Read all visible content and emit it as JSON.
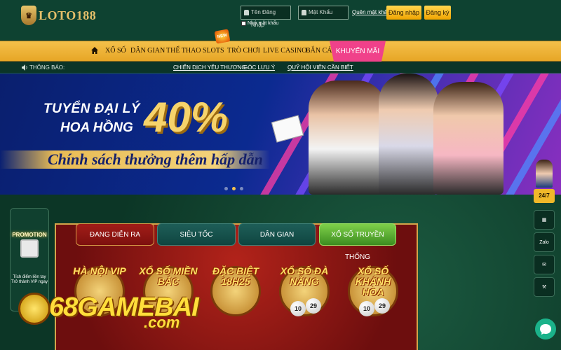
{
  "brand": {
    "logo_text": "LOTO188"
  },
  "login": {
    "username_placeholder": "Tên Đăng Nhập",
    "password_placeholder": "Mật Khẩu",
    "forgot_label": "Quên mật khẩu",
    "remember_label": "Nhớ mật khẩu",
    "login_button": "Đăng nhập",
    "register_button": "Đăng ký"
  },
  "nav": {
    "items": [
      "XỔ SỐ",
      "DÂN GIAN",
      "THỂ THAO",
      "SLOTS",
      "TRÒ CHƠI",
      "LIVE CASINO",
      "BẮN CÁ"
    ],
    "promo_label": "KHUYẾN MÃI",
    "new_badge": "NEW"
  },
  "notice": {
    "label": "THÔNG BÁO:",
    "links": [
      "CHIẾN DỊCH YÊU THƯƠNG",
      "GÓC LƯU Ý",
      "QUỸ HỘI VIÊN CẦN BIẾT"
    ]
  },
  "banner": {
    "line1": "TUYỂN ĐẠI LÝ",
    "line2": "HOA HỒNG",
    "percent": "40%",
    "slogan": "Chính sách thưởng thêm hấp dẫn",
    "slide_count": 3,
    "active_slide": 2
  },
  "promotion": {
    "title": "PROMOTION",
    "description": "Tích điểm liền tay Trở thành VIP ngay"
  },
  "game_tabs": [
    "ĐANG DIỄN RA",
    "SIÊU TỐC",
    "DÂN GIAN",
    "XỔ SỐ TRUYỀN THỐNG"
  ],
  "games": [
    {
      "name": "HÀ NỘI VIP",
      "balls": []
    },
    {
      "name": "XỔ SỐ MIỀN BẮC",
      "balls": []
    },
    {
      "name": "ĐẶC BIỆT 18H25",
      "balls": []
    },
    {
      "name": "XỔ SỐ ĐÀ NẴNG",
      "balls": [
        "10",
        "29"
      ]
    },
    {
      "name": "XỔ SỐ KHÁNH HÒA",
      "balls": [
        "10",
        "29"
      ]
    }
  ],
  "watermark": {
    "text": "68GAMEBAI",
    "sub": ".com"
  },
  "right_bar": {
    "support": "24/7",
    "zalo": "Zalo"
  },
  "colors": {
    "header_bg": "#0e4231",
    "nav_gold": "#f4c04a",
    "promo_pink": "#f0418a",
    "accent_yellow": "#ffd54f",
    "panel_red": "#b2231a"
  }
}
